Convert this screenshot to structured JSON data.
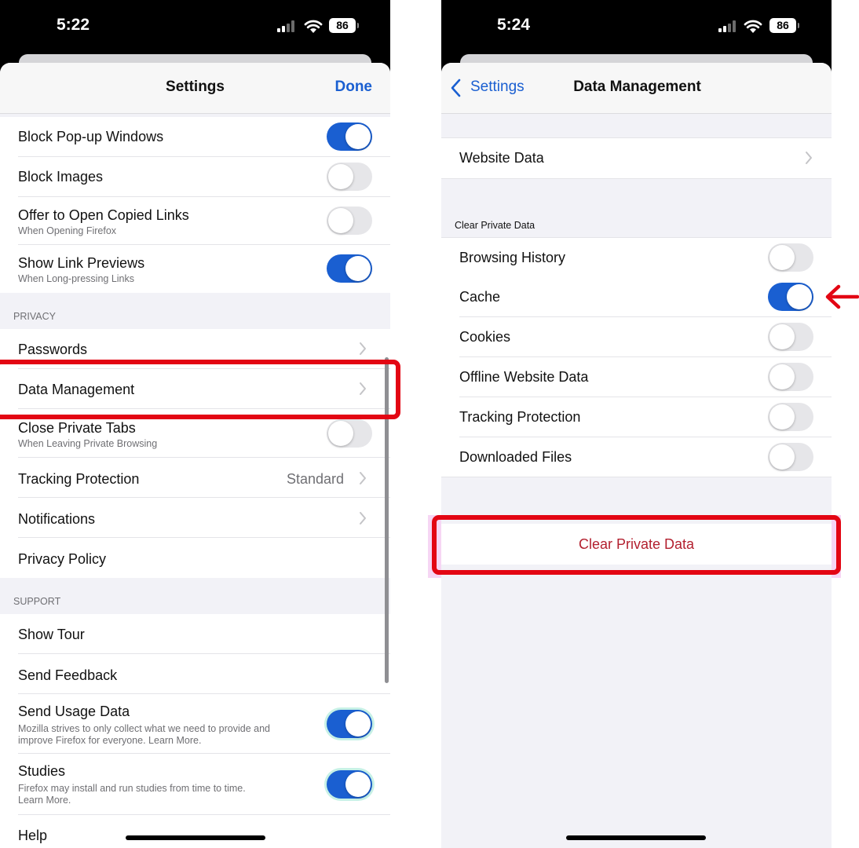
{
  "left_phone": {
    "status_time": "5:22",
    "battery": "86",
    "nav_title": "Settings",
    "done_label": "Done",
    "general_rows": [
      {
        "label": "Block Pop-up Windows",
        "toggle": "on"
      },
      {
        "label": "Block Images",
        "toggle": "off"
      },
      {
        "label": "Offer to Open Copied Links",
        "subtitle": "When Opening Firefox",
        "toggle": "off"
      },
      {
        "label": "Show Link Previews",
        "subtitle": "When Long-pressing Links",
        "toggle": "on"
      }
    ],
    "privacy_header": "PRIVACY",
    "privacy_rows": [
      {
        "label": "Passwords"
      },
      {
        "label": "Data Management"
      },
      {
        "label": "Close Private Tabs",
        "subtitle": "When Leaving Private Browsing",
        "toggle": "off"
      },
      {
        "label": "Tracking Protection",
        "value": "Standard"
      },
      {
        "label": "Notifications"
      },
      {
        "label": "Privacy Policy"
      }
    ],
    "support_header": "SUPPORT",
    "support_rows": [
      {
        "label": "Show Tour"
      },
      {
        "label": "Send Feedback"
      },
      {
        "label": "Send Usage Data",
        "subtitle_line1": "Mozilla strives to only collect what we need to provide and",
        "subtitle_line2": "improve Firefox for everyone. Learn More.",
        "toggle": "on"
      },
      {
        "label": "Studies",
        "subtitle_line1": "Firefox may install and run studies from time to time.",
        "subtitle_line2": "Learn More.",
        "toggle": "on"
      },
      {
        "label": "Help"
      }
    ]
  },
  "right_phone": {
    "status_time": "5:24",
    "battery": "86",
    "back_label": "Settings",
    "nav_title": "Data Management",
    "website_data_label": "Website Data",
    "clear_section_header": "Clear Private Data",
    "clear_rows": [
      {
        "label": "Browsing History",
        "toggle": "off"
      },
      {
        "label": "Cache",
        "toggle": "on"
      },
      {
        "label": "Cookies",
        "toggle": "off"
      },
      {
        "label": "Offline Website Data",
        "toggle": "off"
      },
      {
        "label": "Tracking Protection",
        "toggle": "off"
      },
      {
        "label": "Downloaded Files",
        "toggle": "off"
      }
    ],
    "clear_button_label": "Clear Private Data"
  },
  "colors": {
    "accent_blue": "#1a5fd1",
    "highlight_red": "#e30613",
    "destructive_text": "#b3202f"
  }
}
